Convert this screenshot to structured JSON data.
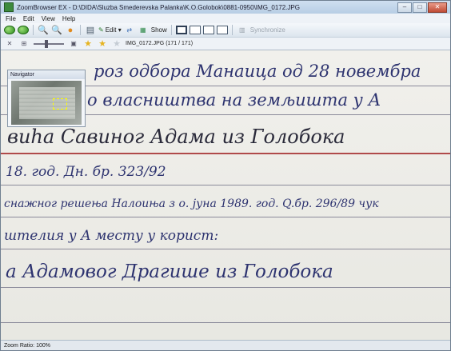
{
  "window": {
    "title": "ZoomBrowser EX - D:\\DIDA\\Sluzba Smederevska Palanka\\K.O.Golobok\\0881-0950\\IMG_0172.JPG",
    "buttons": {
      "minimize": "–",
      "maximize": "□",
      "close": "✕"
    }
  },
  "menu": [
    "File",
    "Edit",
    "View",
    "Help"
  ],
  "toolbar": {
    "edit_label": "Edit ▾",
    "show_label": "Show",
    "synchronize_label": "Synchronize"
  },
  "toolbar2": {
    "filename": "IMG_0172.JPG (171 / 171)"
  },
  "navigator": {
    "title": "Navigator"
  },
  "document": {
    "lines": [
      "роз одбора Манаица од 28 новембра",
      "о власништва на земљишта у А",
      "виhа Савиног Адама из Голобока",
      "18. год. Дн. бр. 323/92",
      "снажног решења Налоиња з о. јуна 1989. год. Q.бр. 296/89 чук",
      "штелия у А месту у корист:",
      "а Адамовог Драгише из Голобока"
    ]
  },
  "status": {
    "zoom": "Zoom Ratio: 100%"
  }
}
